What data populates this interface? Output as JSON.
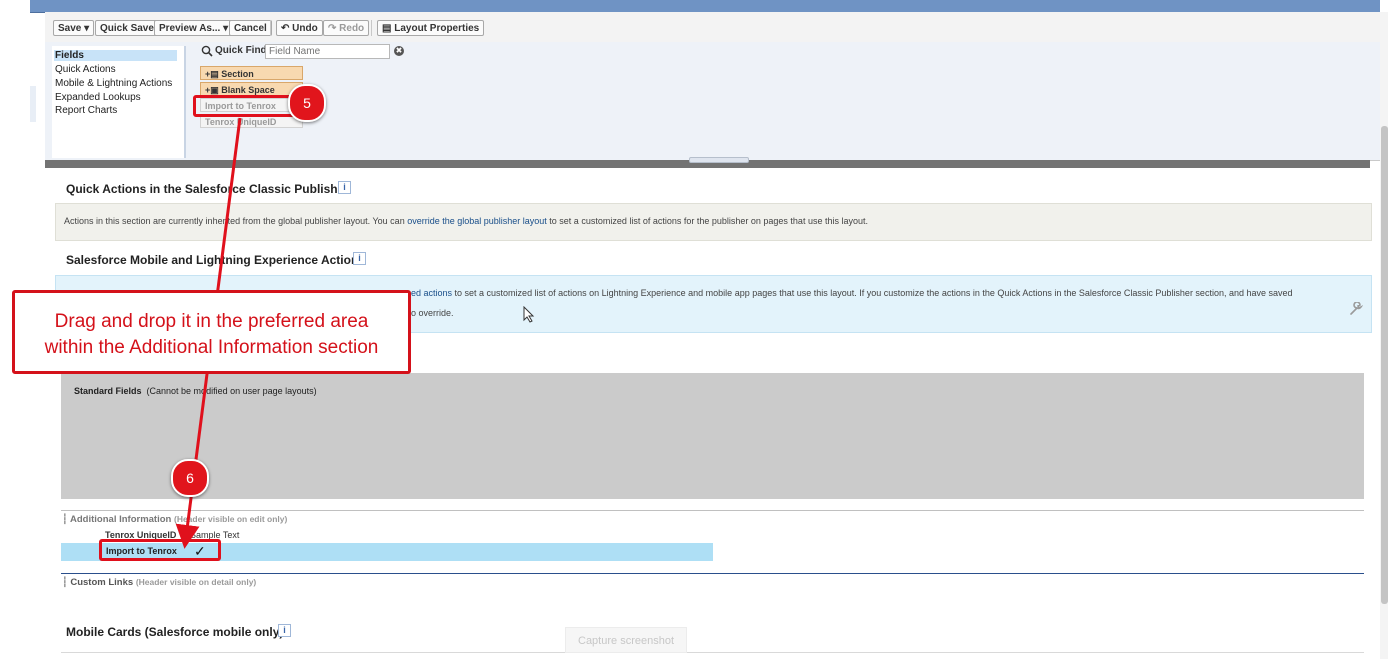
{
  "toolbar": {
    "save_label": "Save ▾",
    "quick_save_label": "Quick Save",
    "preview_as_label": "Preview As... ▾",
    "cancel_label": "Cancel",
    "undo_label": "↶ Undo",
    "redo_label": "↷ Redo",
    "layout_properties_label": "▤ Layout Properties"
  },
  "palette": {
    "categories": [
      "Fields",
      "Quick Actions",
      "Mobile & Lightning Actions",
      "Expanded Lookups",
      "Report Charts"
    ],
    "quick_find_label": "Quick Find",
    "quick_find_placeholder": "Field Name",
    "items": [
      "+▤ Section",
      "+▣ Blank Space",
      "Import to Tenrox",
      "Tenrox UniqueID"
    ]
  },
  "sections": {
    "classic_publisher_title": "Quick Actions in the Salesforce Classic Publisher",
    "classic_text_pre": "Actions in this section are currently inherited from the global publisher layout. You can ",
    "classic_link": "override the global publisher layout",
    "classic_text_post": " to set a customized list of actions for the publisher on pages that use this layout.",
    "mobile_actions_title": "Salesforce Mobile and Lightning Experience Actions",
    "mobile_text_line1_pre": "",
    "mobile_text_line1_link": "ed actions",
    "mobile_text_line1_post": " to set a customized list of actions on Lightning Experience and mobile app pages that use this layout. If you customize the actions in the Quick Actions in the Salesforce Classic Publisher section, and have saved",
    "mobile_text_line2": "o override.",
    "standard_fields_label": "Standard Fields",
    "standard_fields_note": "(Cannot be modified on user page layouts)",
    "additional_info_label": "Additional Information",
    "additional_info_note": "(Header visible on edit only)",
    "field_row_1_name": "Tenrox UniqueID",
    "field_row_1_value": "Sample Text",
    "field_row_2_name": "Import to Tenrox",
    "field_row_2_check": "✓",
    "custom_links_label": "Custom Links",
    "custom_links_note": "(Header visible on detail only)",
    "mobile_cards_title": "Mobile Cards (Salesforce mobile only)",
    "info_icon_glyph": "i"
  },
  "annotations": {
    "step5": "5",
    "step6": "6",
    "callout_line1": "Drag and drop it in the preferred area",
    "callout_line2": "within the Additional Information section",
    "watermark": "Capture screenshot",
    "color_red": "#e0101c"
  },
  "icons": {
    "clear": "✖",
    "search": "search-icon",
    "wrench": "wrench-icon"
  }
}
